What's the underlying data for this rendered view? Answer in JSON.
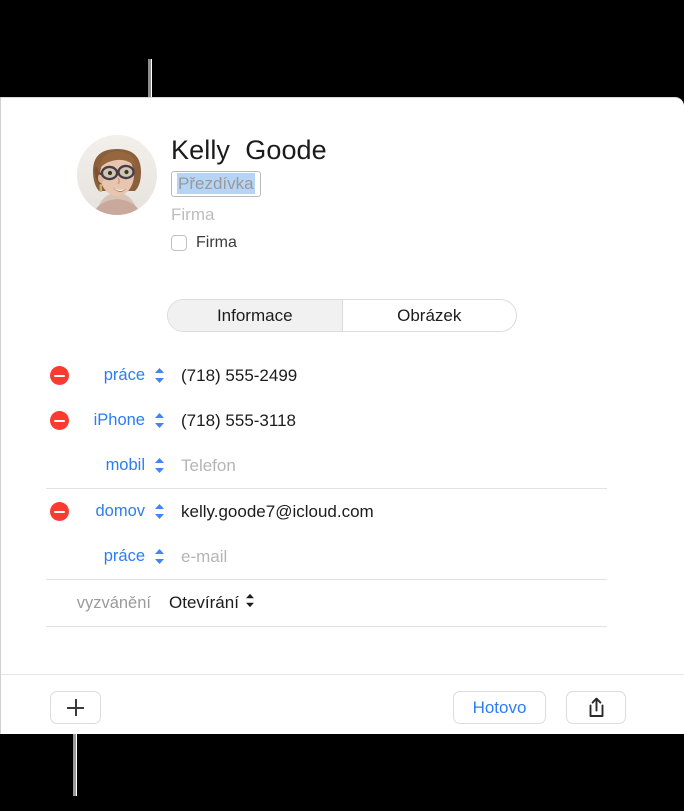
{
  "callouts": {
    "top_pointer_target": "nickname-field",
    "bottom_pointer_target": "add-field-button"
  },
  "contact": {
    "first_name": "Kelly",
    "last_name": "Goode",
    "full_name": "Kelly  Goode",
    "nickname_placeholder": "Přezdívka",
    "company_placeholder": "Firma",
    "company_checkbox_label": "Firma",
    "avatar_alt": "contact-photo"
  },
  "tabs": [
    {
      "label": "Informace",
      "selected": true
    },
    {
      "label": "Obrázek",
      "selected": false
    }
  ],
  "phone_rows": [
    {
      "removable": true,
      "label": "práce",
      "value": "(718) 555-2499",
      "is_placeholder": false
    },
    {
      "removable": true,
      "label": "iPhone",
      "value": "(718) 555-3118",
      "is_placeholder": false
    },
    {
      "removable": false,
      "label": "mobil",
      "value": "Telefon",
      "is_placeholder": true
    }
  ],
  "email_rows": [
    {
      "removable": true,
      "label": "domov",
      "value": "kelly.goode7@icloud.com",
      "is_placeholder": false
    },
    {
      "removable": false,
      "label": "práce",
      "value": "e-mail",
      "is_placeholder": true
    }
  ],
  "ringtone": {
    "label": "vyzvánění",
    "value": "Otevírání"
  },
  "toolbar": {
    "add_label": "+",
    "done_label": "Hotovo",
    "share_label": "share-icon"
  },
  "colors": {
    "accent_blue": "#2d7cf6",
    "delete_red": "#fc3b30",
    "selection_blue": "#b6d4f5",
    "placeholder_gray": "#b5b5b5",
    "backdrop": "#000000"
  }
}
